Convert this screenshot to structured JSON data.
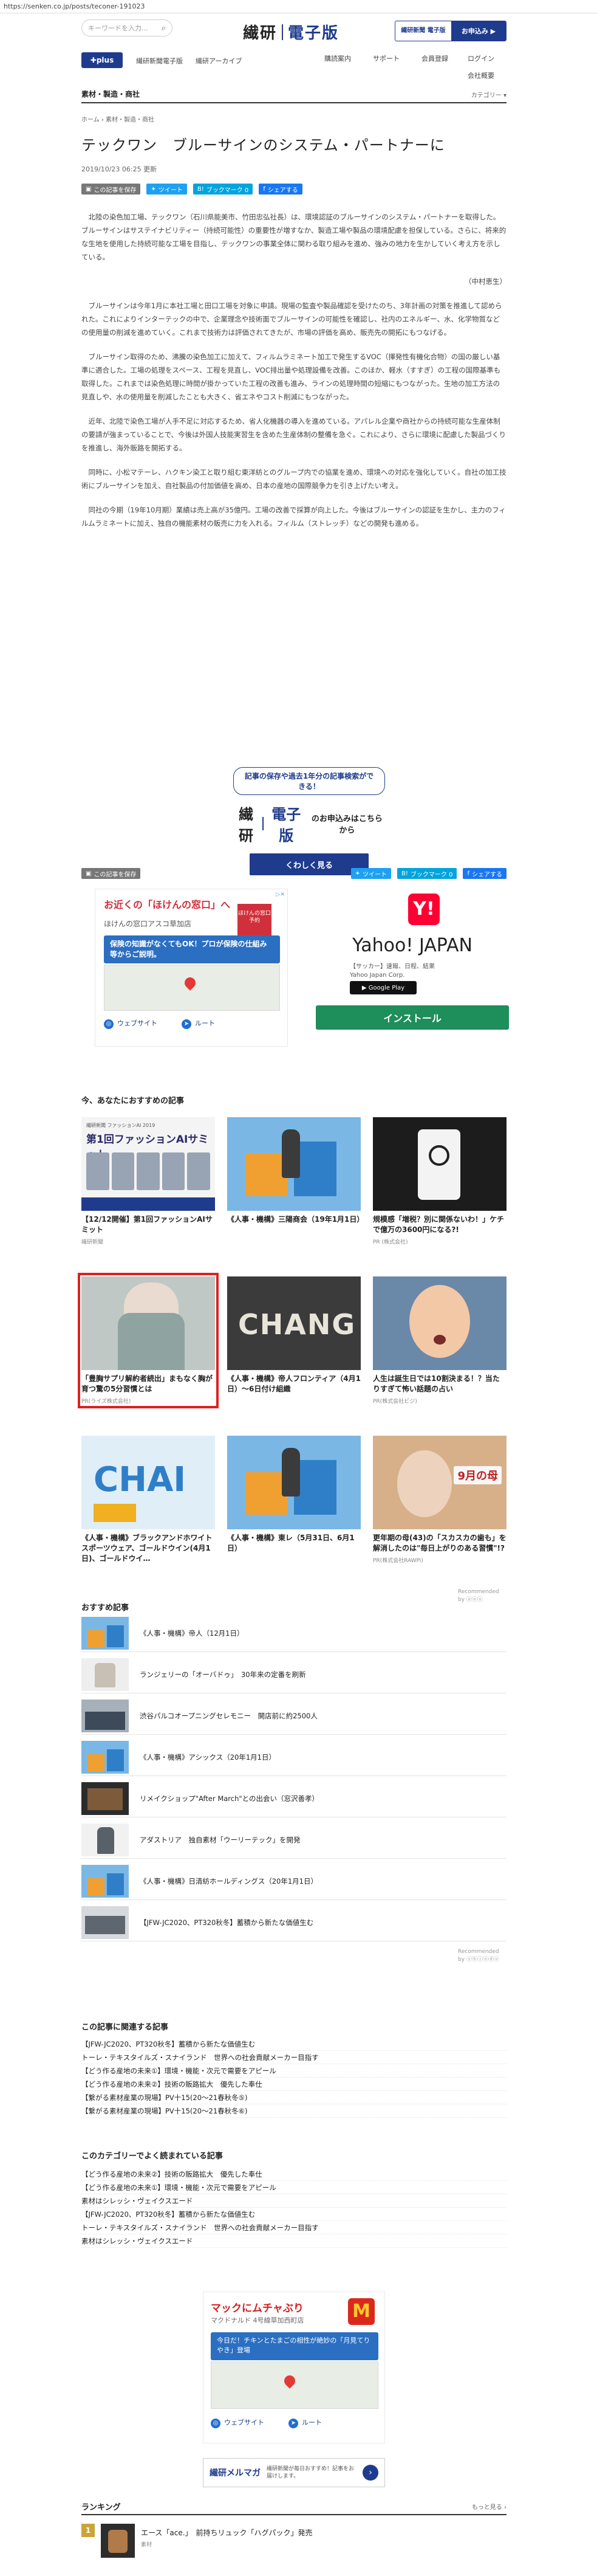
{
  "url": "https://senken.co.jp/posts/teconer-191023",
  "header": {
    "search_placeholder": "キーワードを入力...",
    "logo_main": "繊研",
    "logo_sub": "電子版",
    "promo_left": "繊研新聞 電子版",
    "promo_right": "お申込み ▶"
  },
  "nav": {
    "plus_label": "✚plus",
    "items": [
      "繊研新聞電子版",
      "繊研アーカイブ"
    ],
    "right_items": [
      "購読案内",
      "サポート",
      "会員登録",
      "ログイン"
    ],
    "right_sub": "会社概要"
  },
  "category": {
    "label": "素材・製造・商社",
    "more": "カテゴリー ▾"
  },
  "article": {
    "breadcrumb": "ホーム › 素材・製造・商社",
    "title": "テックワン　ブルーサインのシステム・パートナーに",
    "date": "2019/10/23 06:25 更新",
    "share": {
      "save": "この記事を保存",
      "tweet": "ツイート",
      "hatena": "ブックマーク 0",
      "facebook": "シェアする"
    },
    "paragraphs": [
      "北陸の染色加工場、テックワン（石川県能美市、竹田忠弘社長）は、環境認証のブルーサインのシステム・パートナーを取得した。ブルーサインはサステイナビリティー（持続可能性）の重要性が増すなか、製造工場や製品の環境配慮を担保している。さらに、将来的な生地を使用した持続可能な工場を目指し、テックワンの事業全体に関わる取り組みを進め、強みの地力を生かしていく考え方を示している。",
      "（中村恵生）",
      "ブルーサインは今年1月に本社工場と田口工場を対象に申請。現場の監査や製品確認を受けたのち、3年計画の対策を推進して認められた。これによりインターテックの中で、企業理念や技術面でブルーサインの可能性を確認し、社内のエネルギー、水、化学物質などの使用量の削減を進めていく。これまで技術力は評価されてきたが、市場の評価を高め、販売先の開拓にもつなげる。",
      "ブルーサイン取得のため、沸騰の染色加工に加えて、フィルムラミネート加工で発生するVOC（揮発性有機化合物）の国の厳しい基準に適合した。工場の処理をスペース、工程を見直し、VOC排出量や処理設備を改善。このほか、軽水（すすぎ）の工程の国際基準も取得した。これまでは染色処理に時間が掛かっていた工程の改善も進み、ラインの処理時間の短縮にもつながった。生地の加工方法の見直しや、水の使用量を削減したことも大きく、省エネやコスト削減にもつながった。",
      "近年、北陸で染色工場が人手不足に対応するため、省人化機器の導入を進めている。アパレル企業や商社からの持続可能な生産体制の要請が強まっていることで、今後は外国人技能実習生を含めた生産体制の整備を急ぐ。これにより、さらに環境に配慮した製品づくりを推進し、海外販路を開拓する。",
      "同時に、小松マテーレ、ハクキン染工と取り組む東洋紡とのグループ内での協業を進め、環境への対応を強化していく。自社の加工技術にブルーサインを加え、自社製品の付加価値を高め、日本の産地の国際競争力を引き上げたい考え。",
      "同社の今期（19年10月期）業績は売上高が35億円。工場の改善で採算が向上した。今後はブルーサインの認証を生かし、主力のフィルムラミネートに加え、独自の機能素材の販売に力を入れる。フィルム（ストレッチ）などの開発も進める。"
    ]
  },
  "subscribe": {
    "bubble": "記事の保存や過去1年分の記事検索ができる！",
    "brand_main": "繊研",
    "brand_sub": "電子版",
    "tail": "のお申込みはこちらから",
    "cta": "くわしく見る"
  },
  "ad_left": {
    "title": "お近くの「ほけんの窓口」へ",
    "sub": "ほけんの窓口アスコ草加店",
    "badge": "ほけんの窓口 予約",
    "blue": "保険の知識がなくてもOK！プロが保険の仕組み等からご説明。",
    "btn1": "ウェブサイト",
    "btn2": "ルート",
    "adchoice": "▷✕"
  },
  "ad_right": {
    "logo": "Y!",
    "name": "Yahoo! JAPAN",
    "meta1": "【サッカー】速報、日程、結果",
    "meta2": "Yahoo Japan Corp.",
    "store": "▶ Google Play",
    "install": "インストール"
  },
  "recommend": {
    "title": "今、あなたにおすすめの記事",
    "cards": [
      {
        "title": "【12/12開催】第1回ファッションAIサミット",
        "src": "",
        "art": "event",
        "event_header": "繊研新聞 ファッションAI 2019",
        "event_big": "第1回ファッションAIサミット"
      },
      {
        "title": "《人事・機構》三陽商会（19年1月1日）",
        "src": "",
        "art": "puzzle"
      },
      {
        "title": "規模感「増税？別に関係ないわ！」ケチで億万の3600円になる?!",
        "src": "PR (株式会社)",
        "art": "device"
      },
      {
        "title": "「豊胸サプリ解約者続出」まもなく胸が育つ驚の5分習慣とは",
        "src": "PR(ライズ株式会社)",
        "art": "woman"
      },
      {
        "title": "《人事・機構》帝人フロンティア（4月1日）～6日付け組織",
        "src": "",
        "art": "change",
        "word": "CHANG"
      },
      {
        "title": "人生は誕生日では10割決まる！？当たりすぎて怖い話題の占い",
        "src": "PR(株式会社ビジ)",
        "art": "baby"
      },
      {
        "title": "《人事・機構》ブラックアンドホワイトスポーツウェア、ゴールドウイン(4月1日)、ゴールドウイ…",
        "src": "",
        "art": "chai",
        "word": "CHAI"
      },
      {
        "title": "《人事・機構》東レ（5月31日、6月1日）",
        "src": "",
        "art": "puzzle"
      },
      {
        "title": "更年期の母(43)の「スカスカの歯も」を解消したのは\"毎日上がりのある習慣\"!?",
        "src": "PR(株式会社RAWPi)",
        "art": "mom",
        "label": "9月の母"
      }
    ],
    "pwr": "Recommended by ⓤⓞⓤ",
    "src_tag": "繊研新聞"
  },
  "osusume": {
    "title": "おすすめ記事",
    "rows": [
      {
        "text": "《人事・機構》帝人（12月1日）",
        "art": "puzzle"
      },
      {
        "text": "ランジェリーの「オーバドゥ」　30年来の定番を刷新",
        "art": "shirt"
      },
      {
        "text": "渋谷パルコオープニングセレモニー　開店前に約2500人",
        "art": "people"
      },
      {
        "text": "《人事・機構》アシックス（20年1月1日）",
        "art": "puzzle"
      },
      {
        "text": "リメイクショップ\"After March\"との出会い（窓沢善孝）",
        "art": "books"
      },
      {
        "text": "アダストリア　独自素材「ウーリーテック」を開発",
        "art": "coat"
      },
      {
        "text": "《人事・機構》日清紡ホールディングス（20年1月1日）",
        "art": "puzzle"
      },
      {
        "text": "【JFW-JC2020、PT320秋冬】蓄積から新たな価値生む",
        "art": "jfw"
      }
    ],
    "pwr": "Recommended by ⓢⓗⓘⓝⓓⓞ"
  },
  "related": {
    "title": "この記事に関連する記事",
    "items": [
      "【JFW-JC2020、PT320秋冬】蓄積から新たな価値生む",
      "トーレ・テキスタイルズ・スナイランド　世界への社会貢献メーカー目指す",
      "【どう作る産地の未来①】環境・機能・次元で需要をアピール",
      "【どう作る産地の未来②】技術の販路拡大　優先した奉仕",
      "【繋がる素材産業の現場】PV十15(20〜21春秋冬⑤)",
      "【繋がる素材産業の現場】PV十15(20〜21春秋冬⑥)"
    ]
  },
  "category_popular": {
    "title": "このカテゴリーでよく読まれている記事",
    "items": [
      "【どう作る産地の未来②】技術の販路拡大　優先した奉仕",
      "【どう作る産地の未来①】環境・機能・次元で需要をアピール",
      "素材はシレッシ・ヴェイクスエード",
      "【JFW-JC2020、PT320秋冬】蓄積から新たな価値生む",
      "トーレ・テキスタイルズ・スナイランド　世界への社会貢献メーカー目指す",
      "素材はシレッシ・ヴェイクスエード"
    ]
  },
  "ad_mc": {
    "t1": "マックにムチャぶり",
    "t2": "マクドナルド 4号線草加西町店",
    "logo": "M",
    "blue": "今日だ！チキンとたまごの相性が絶妙の「月見てりやき」登場",
    "btn1": "ウェブサイト",
    "btn2": "ルート"
  },
  "mail": {
    "name": "繊研メルマガ",
    "desc": "繊研新聞が毎日おすすめ！記事をお届けします。",
    "go": "›"
  },
  "ranking": {
    "title": "ランキング",
    "more": "もっと見る ›",
    "item": {
      "num": "1",
      "text": "エース「ace.」　前持ちリュック「ハグパック」発売",
      "src": "素材"
    }
  }
}
